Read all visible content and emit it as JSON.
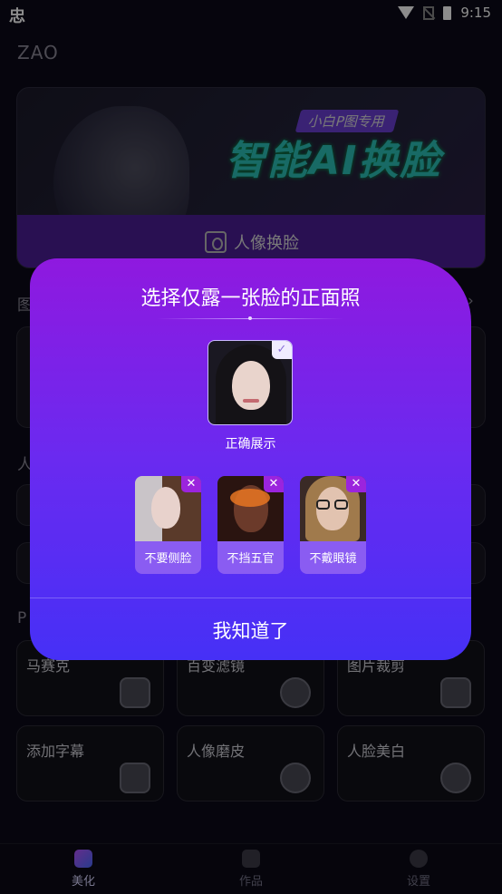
{
  "status_bar": {
    "time": "9:15",
    "left_icon": "忠"
  },
  "app": {
    "title": "ZAO"
  },
  "banner": {
    "tag": "小白P图专用",
    "headline": "智能AI换脸",
    "button_label": "人像换脸"
  },
  "sections": {
    "label_a": "图",
    "label_b": "人",
    "label_c": "P"
  },
  "tools": [
    {
      "label": "马赛克",
      "icon": "mosaic-icon"
    },
    {
      "label": "百变滤镜",
      "icon": "filter-icon"
    },
    {
      "label": "图片裁剪",
      "icon": "crop-icon"
    },
    {
      "label": "添加字幕",
      "icon": "subtitle-icon"
    },
    {
      "label": "人像磨皮",
      "icon": "smooth-skin-icon"
    },
    {
      "label": "人脸美白",
      "icon": "whiten-icon"
    }
  ],
  "bottom_nav": [
    {
      "label": "美化",
      "active": true
    },
    {
      "label": "作品",
      "active": false
    },
    {
      "label": "设置",
      "active": false
    }
  ],
  "dialog": {
    "title": "选择仅露一张脸的正面照",
    "example_caption": "正确展示",
    "bad_examples": [
      {
        "label": "不要侧脸"
      },
      {
        "label": "不挡五官"
      },
      {
        "label": "不戴眼镜"
      }
    ],
    "confirm_label": "我知道了"
  },
  "colors": {
    "dialog_top": "#8f19df",
    "dialog_bottom": "#4630f6",
    "accent": "#2cc1b8"
  }
}
